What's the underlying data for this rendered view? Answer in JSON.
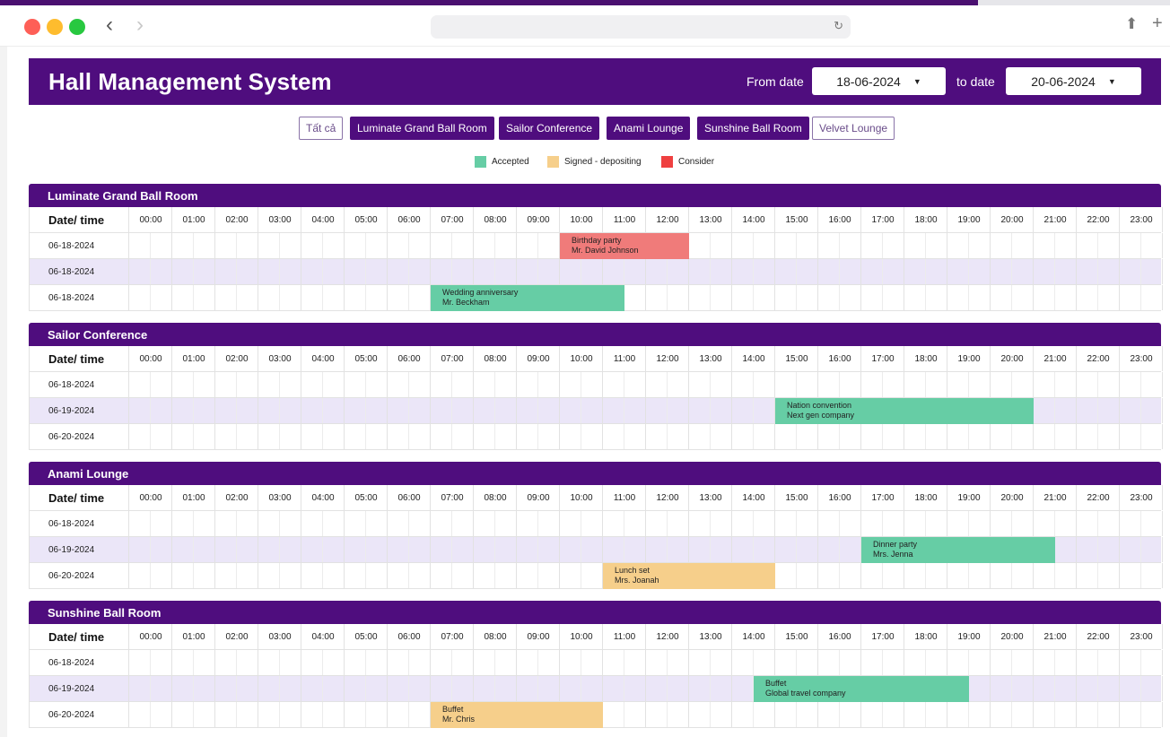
{
  "app": {
    "title": "Hall Management System",
    "from_label": "From date",
    "from_value": "18-06-2024",
    "to_label": "to date",
    "to_value": "20-06-2024"
  },
  "filters": [
    {
      "label": "Tất cả",
      "active": false
    },
    {
      "label": "Luminate Grand Ball Room",
      "active": true
    },
    {
      "label": "Sailor Conference",
      "active": true
    },
    {
      "label": "Anami Lounge",
      "active": true
    },
    {
      "label": "Sunshine Ball Room",
      "active": true
    },
    {
      "label": "Velvet Lounge",
      "active": false
    }
  ],
  "legend": [
    {
      "label": "Accepted",
      "color": "#66cda5"
    },
    {
      "label": "Signed - depositing",
      "color": "#f6cf8b"
    },
    {
      "label": "Consider",
      "color": "#ef4040"
    }
  ],
  "colors": {
    "primary": "#4f0d7e",
    "accepted": "#66cda5",
    "signed": "#f6cf8b",
    "consider": "#f07b7a",
    "alt_row": "#ebe6f8"
  },
  "date_time_header": "Date/ time",
  "hours": [
    "00:00",
    "01:00",
    "02:00",
    "03:00",
    "04:00",
    "05:00",
    "06:00",
    "07:00",
    "08:00",
    "09:00",
    "10:00",
    "11:00",
    "12:00",
    "13:00",
    "14:00",
    "15:00",
    "16:00",
    "17:00",
    "18:00",
    "19:00",
    "20:00",
    "21:00",
    "22:00",
    "23:00"
  ],
  "rooms": [
    {
      "name": "Luminate Grand Ball Room",
      "rows": [
        {
          "date": "06-18-2024",
          "events": [
            {
              "title": "Birthday party",
              "guest": "Mr. David Johnson",
              "status": "consider",
              "start": 10,
              "end": 13
            }
          ]
        },
        {
          "date": "06-18-2024",
          "events": []
        },
        {
          "date": "06-18-2024",
          "events": [
            {
              "title": "Wedding anniversary",
              "guest": "Mr. Beckham",
              "status": "accepted",
              "start": 7,
              "end": 11.5
            }
          ]
        }
      ]
    },
    {
      "name": "Sailor Conference",
      "rows": [
        {
          "date": "06-18-2024",
          "events": []
        },
        {
          "date": "06-19-2024",
          "events": [
            {
              "title": "Nation convention",
              "guest": "Next gen company",
              "status": "accepted",
              "start": 15,
              "end": 21
            }
          ]
        },
        {
          "date": "06-20-2024",
          "events": []
        }
      ]
    },
    {
      "name": "Anami Lounge",
      "rows": [
        {
          "date": "06-18-2024",
          "events": []
        },
        {
          "date": "06-19-2024",
          "events": [
            {
              "title": "Dinner party",
              "guest": "Mrs. Jenna",
              "status": "accepted",
              "start": 17,
              "end": 21.5
            }
          ]
        },
        {
          "date": "06-20-2024",
          "events": [
            {
              "title": "Lunch set",
              "guest": "Mrs. Joanah",
              "status": "signed",
              "start": 11,
              "end": 15
            }
          ]
        }
      ]
    },
    {
      "name": "Sunshine Ball Room",
      "rows": [
        {
          "date": "06-18-2024",
          "events": []
        },
        {
          "date": "06-19-2024",
          "events": [
            {
              "title": "Buffet",
              "guest": "Global travel company",
              "status": "accepted",
              "start": 14.5,
              "end": 19.5
            }
          ]
        },
        {
          "date": "06-20-2024",
          "events": [
            {
              "title": "Buffet",
              "guest": "Mr. Chris",
              "status": "signed",
              "start": 7,
              "end": 11
            }
          ]
        }
      ]
    }
  ]
}
